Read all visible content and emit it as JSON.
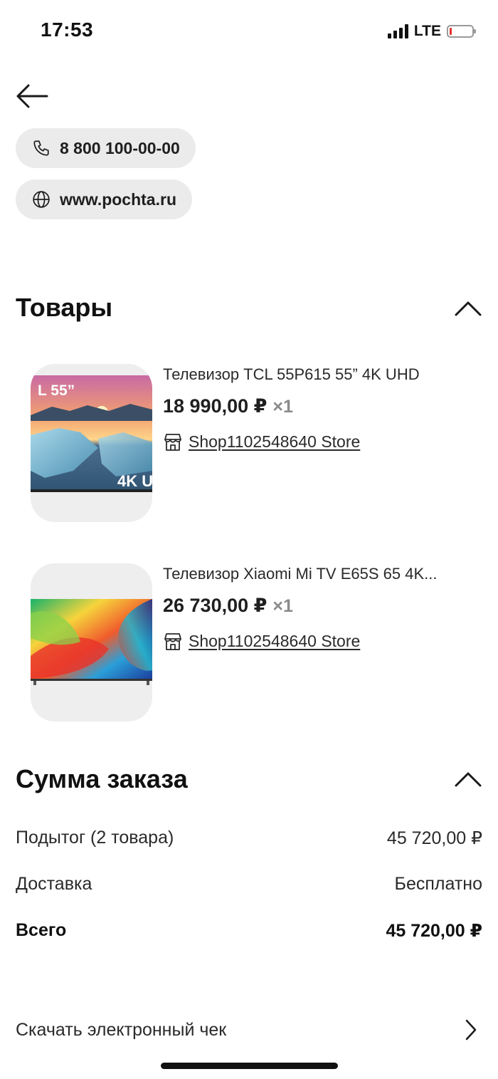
{
  "status_bar": {
    "time": "17:53",
    "network": "LTE",
    "battery_level": 0.1,
    "battery_color": "#e5322d"
  },
  "contacts": {
    "phone": "8 800 100-00-00",
    "website": "www.pochta.ru"
  },
  "products_section": {
    "title": "Товары",
    "items": [
      {
        "name": "Телевизор TCL 55P615 55” 4K UHD",
        "price": "18 990,00 ₽",
        "qty": "×1",
        "store": "Shop1102548640 Store",
        "image_text": [
          "L 55”",
          "4K U"
        ]
      },
      {
        "name": "Телевизор Xiaomi Mi TV E65S 65 4K...",
        "price": "26 730,00 ₽",
        "qty": "×1",
        "store": "Shop1102548640 Store"
      }
    ]
  },
  "order_summary": {
    "title": "Сумма заказа",
    "subtotal_label": "Подытог (2 товара)",
    "subtotal_value": "45 720,00 ₽",
    "delivery_label": "Доставка",
    "delivery_value": "Бесплатно",
    "total_label": "Всего",
    "total_value": "45 720,00 ₽"
  },
  "download_receipt": {
    "label": "Скачать электронный чек"
  },
  "icons": {
    "back": "arrow-left-icon",
    "phone": "phone-icon",
    "web": "globe-icon",
    "collapse": "chevron-up-icon",
    "store": "store-icon",
    "next": "chevron-right-icon"
  }
}
